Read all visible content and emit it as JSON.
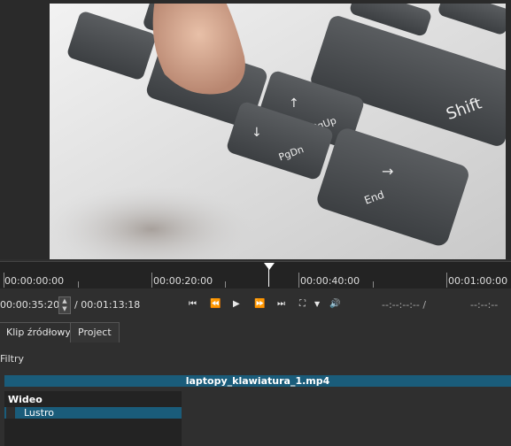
{
  "ruler": {
    "labels": [
      "00:00:00:00",
      "00:00:20:00",
      "00:00:40:00",
      "00:01:00:00"
    ]
  },
  "transport": {
    "position": "00:00:35:20",
    "duration": "/ 00:01:13:18",
    "in_point": "--:--:--:-- /",
    "out_point": "--:--:--"
  },
  "tabs": {
    "source": "Klip źródłowy",
    "project": "Project"
  },
  "filters": {
    "label": "Filtry",
    "clip_name": "laptopy_klawiatura_1.mp4",
    "group": "Wideo",
    "items": [
      "Lustro"
    ]
  },
  "icons": {
    "skip_start": "skip-to-start-icon",
    "rewind": "rewind-icon",
    "play": "play-icon",
    "fast_forward": "fast-forward-icon",
    "skip_end": "skip-to-end-icon",
    "zoom": "zoom-icon",
    "volume": "volume-icon"
  },
  "colors": {
    "accent": "#1a5c7a",
    "background": "#2f2f2f"
  }
}
